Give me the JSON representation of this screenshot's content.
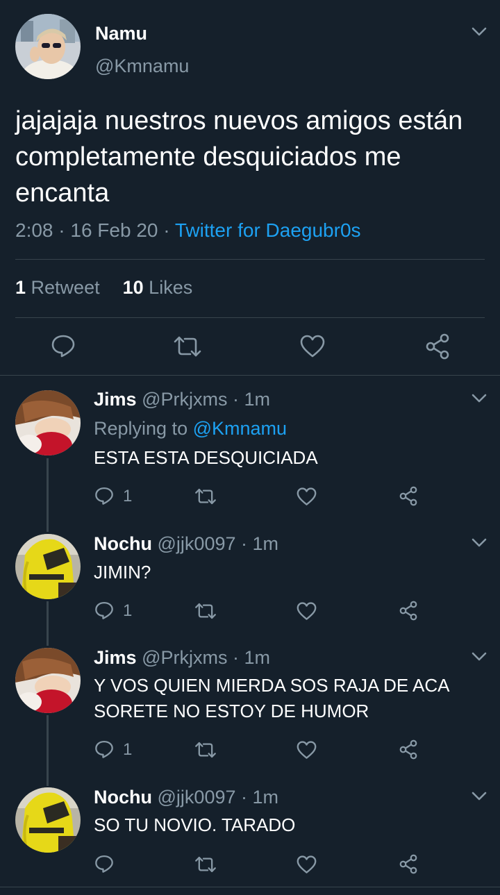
{
  "main_tweet": {
    "author_name": "Namu",
    "author_handle": "@Kmnamu",
    "text": "jajajaja nuestros nuevos amigos están completamente desquiciados me encanta",
    "time_date": "2:08 · 16 Feb 20 · ",
    "client": "Twitter for Daegubr0s",
    "retweets_count": "1",
    "retweets_label": " Retweet",
    "likes_count": "10",
    "likes_label": " Likes"
  },
  "replies": [
    {
      "name": "Jims",
      "handle": "@Prkjxms · 1m",
      "replying_prefix": "Replying to ",
      "replying_to": "@Kmnamu",
      "text": "ESTA ESTA DESQUICIADA",
      "reply_count": "1"
    },
    {
      "name": "Nochu",
      "handle": "@jjk0097 · 1m",
      "text": "JIMIN?",
      "reply_count": "1"
    },
    {
      "name": "Jims",
      "handle": "@Prkjxms · 1m",
      "text": "Y VOS QUIEN MIERDA SOS RAJA DE ACA SORETE NO ESTOY DE HUMOR",
      "reply_count": "1"
    },
    {
      "name": "Nochu",
      "handle": "@jjk0097 · 1m",
      "text": "SO TU NOVIO. TARADO",
      "reply_count": ""
    }
  ],
  "colors": {
    "background": "#15202b",
    "muted": "#8899a6",
    "accent": "#1da1f2",
    "divider": "#38444d"
  },
  "icons": [
    "chevron-down-icon",
    "reply-icon",
    "retweet-icon",
    "like-icon",
    "share-icon"
  ]
}
